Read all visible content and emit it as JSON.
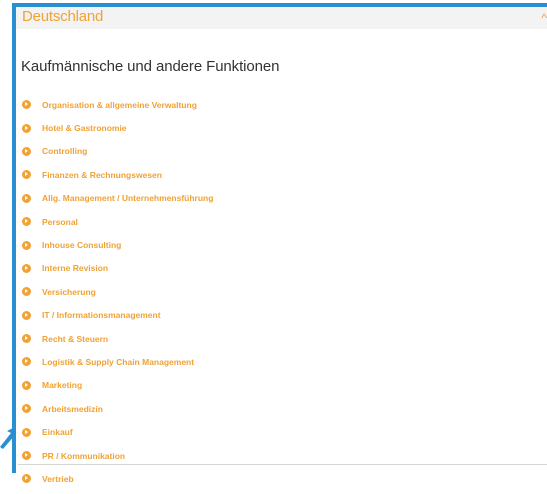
{
  "header": {
    "country": "Deutschland",
    "caret_icon": "chevron-up-icon"
  },
  "section": {
    "title": "Kaufmännische und andere Funktionen"
  },
  "functions": [
    {
      "label": "Organisation & allgemeine Verwaltung"
    },
    {
      "label": "Hotel & Gastronomie"
    },
    {
      "label": "Controlling"
    },
    {
      "label": "Finanzen & Rechnungswesen"
    },
    {
      "label": "Allg. Management / Unternehmensführung"
    },
    {
      "label": "Personal"
    },
    {
      "label": "Inhouse Consulting"
    },
    {
      "label": "Interne Revision"
    },
    {
      "label": "Versicherung"
    },
    {
      "label": "IT / Informationsmanagement"
    },
    {
      "label": "Recht & Steuern"
    },
    {
      "label": "Logistik & Supply Chain Management"
    },
    {
      "label": "Marketing"
    },
    {
      "label": "Arbeitsmedizin"
    },
    {
      "label": "Einkauf"
    },
    {
      "label": "PR / Kommunikation"
    },
    {
      "label": "Vertrieb"
    }
  ],
  "colors": {
    "accent": "#f0a234",
    "frame": "#2a8fd0",
    "text": "#333333"
  }
}
